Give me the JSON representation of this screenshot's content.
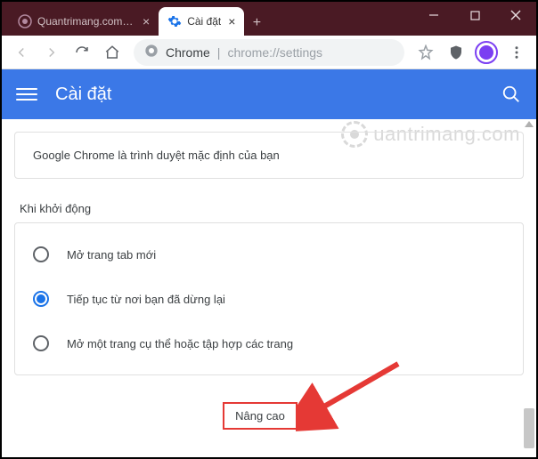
{
  "window": {
    "tabs": [
      {
        "label": "Quantrimang.com: Kiế",
        "active": false,
        "favicon": "quantrimang"
      },
      {
        "label": "Cài đặt",
        "active": true,
        "favicon": "settings-gear"
      }
    ],
    "controls": {
      "minimize": "–",
      "maximize": "□",
      "close": "✕"
    }
  },
  "toolbar": {
    "omnibox_app": "Chrome",
    "omnibox_url": "chrome://settings"
  },
  "settings": {
    "title": "Cài đặt",
    "default_browser_msg": "Google Chrome là trình duyệt mặc định của bạn",
    "startup_section_title": "Khi khởi động",
    "startup_options": [
      {
        "label": "Mở trang tab mới",
        "selected": false
      },
      {
        "label": "Tiếp tục từ nơi bạn đã dừng lại",
        "selected": true
      },
      {
        "label": "Mở một trang cụ thể hoặc tập hợp các trang",
        "selected": false
      }
    ],
    "advanced_label": "Nâng cao"
  },
  "watermark": "uantrimang.com"
}
